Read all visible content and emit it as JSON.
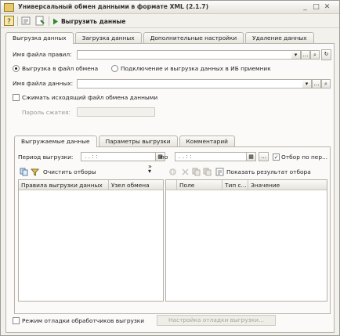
{
  "window": {
    "title": "Универсальный обмен данными в формате XML (2.1.7)"
  },
  "toolbar": {
    "run_label": "Выгрузить данные"
  },
  "main_tabs": [
    "Выгрузка данных",
    "Загрузка данных",
    "Дополнительные настройки",
    "Удаление данных"
  ],
  "rules_file": {
    "label": "Имя файла правил:",
    "value": ""
  },
  "mode": {
    "option1": "Выгрузка в файл обмена",
    "option2": "Подключение и выгрузка данных в ИБ приемник",
    "selected": "option1"
  },
  "data_file": {
    "label": "Имя файла данных:",
    "value": ""
  },
  "compress": {
    "label": "Сжимать исходящий файл обмена данными",
    "checked": false
  },
  "password": {
    "label": "Пароль сжатия:",
    "value": ""
  },
  "inner_tabs": [
    "Выгружаемые данные",
    "Параметры выгрузки",
    "Комментарий"
  ],
  "period": {
    "label": "Период выгрузки:",
    "from": ". .    : :",
    "to_label": "по",
    "to": ". .    : :",
    "filter_label": "Отбор по пер..."
  },
  "left_toolbar": {
    "clear_label": "Очистить отборы"
  },
  "right_toolbar": {
    "show_label": "Показать результат отбора"
  },
  "left_grid": {
    "columns": [
      "Правила выгрузки данных",
      "Узел обмена"
    ]
  },
  "right_grid": {
    "columns": [
      "Поле",
      "Тип с...",
      "Значение"
    ]
  },
  "debug": {
    "label": "Режим отладки обработчиков выгрузки",
    "button": "Настройка отладки выгрузки..."
  }
}
